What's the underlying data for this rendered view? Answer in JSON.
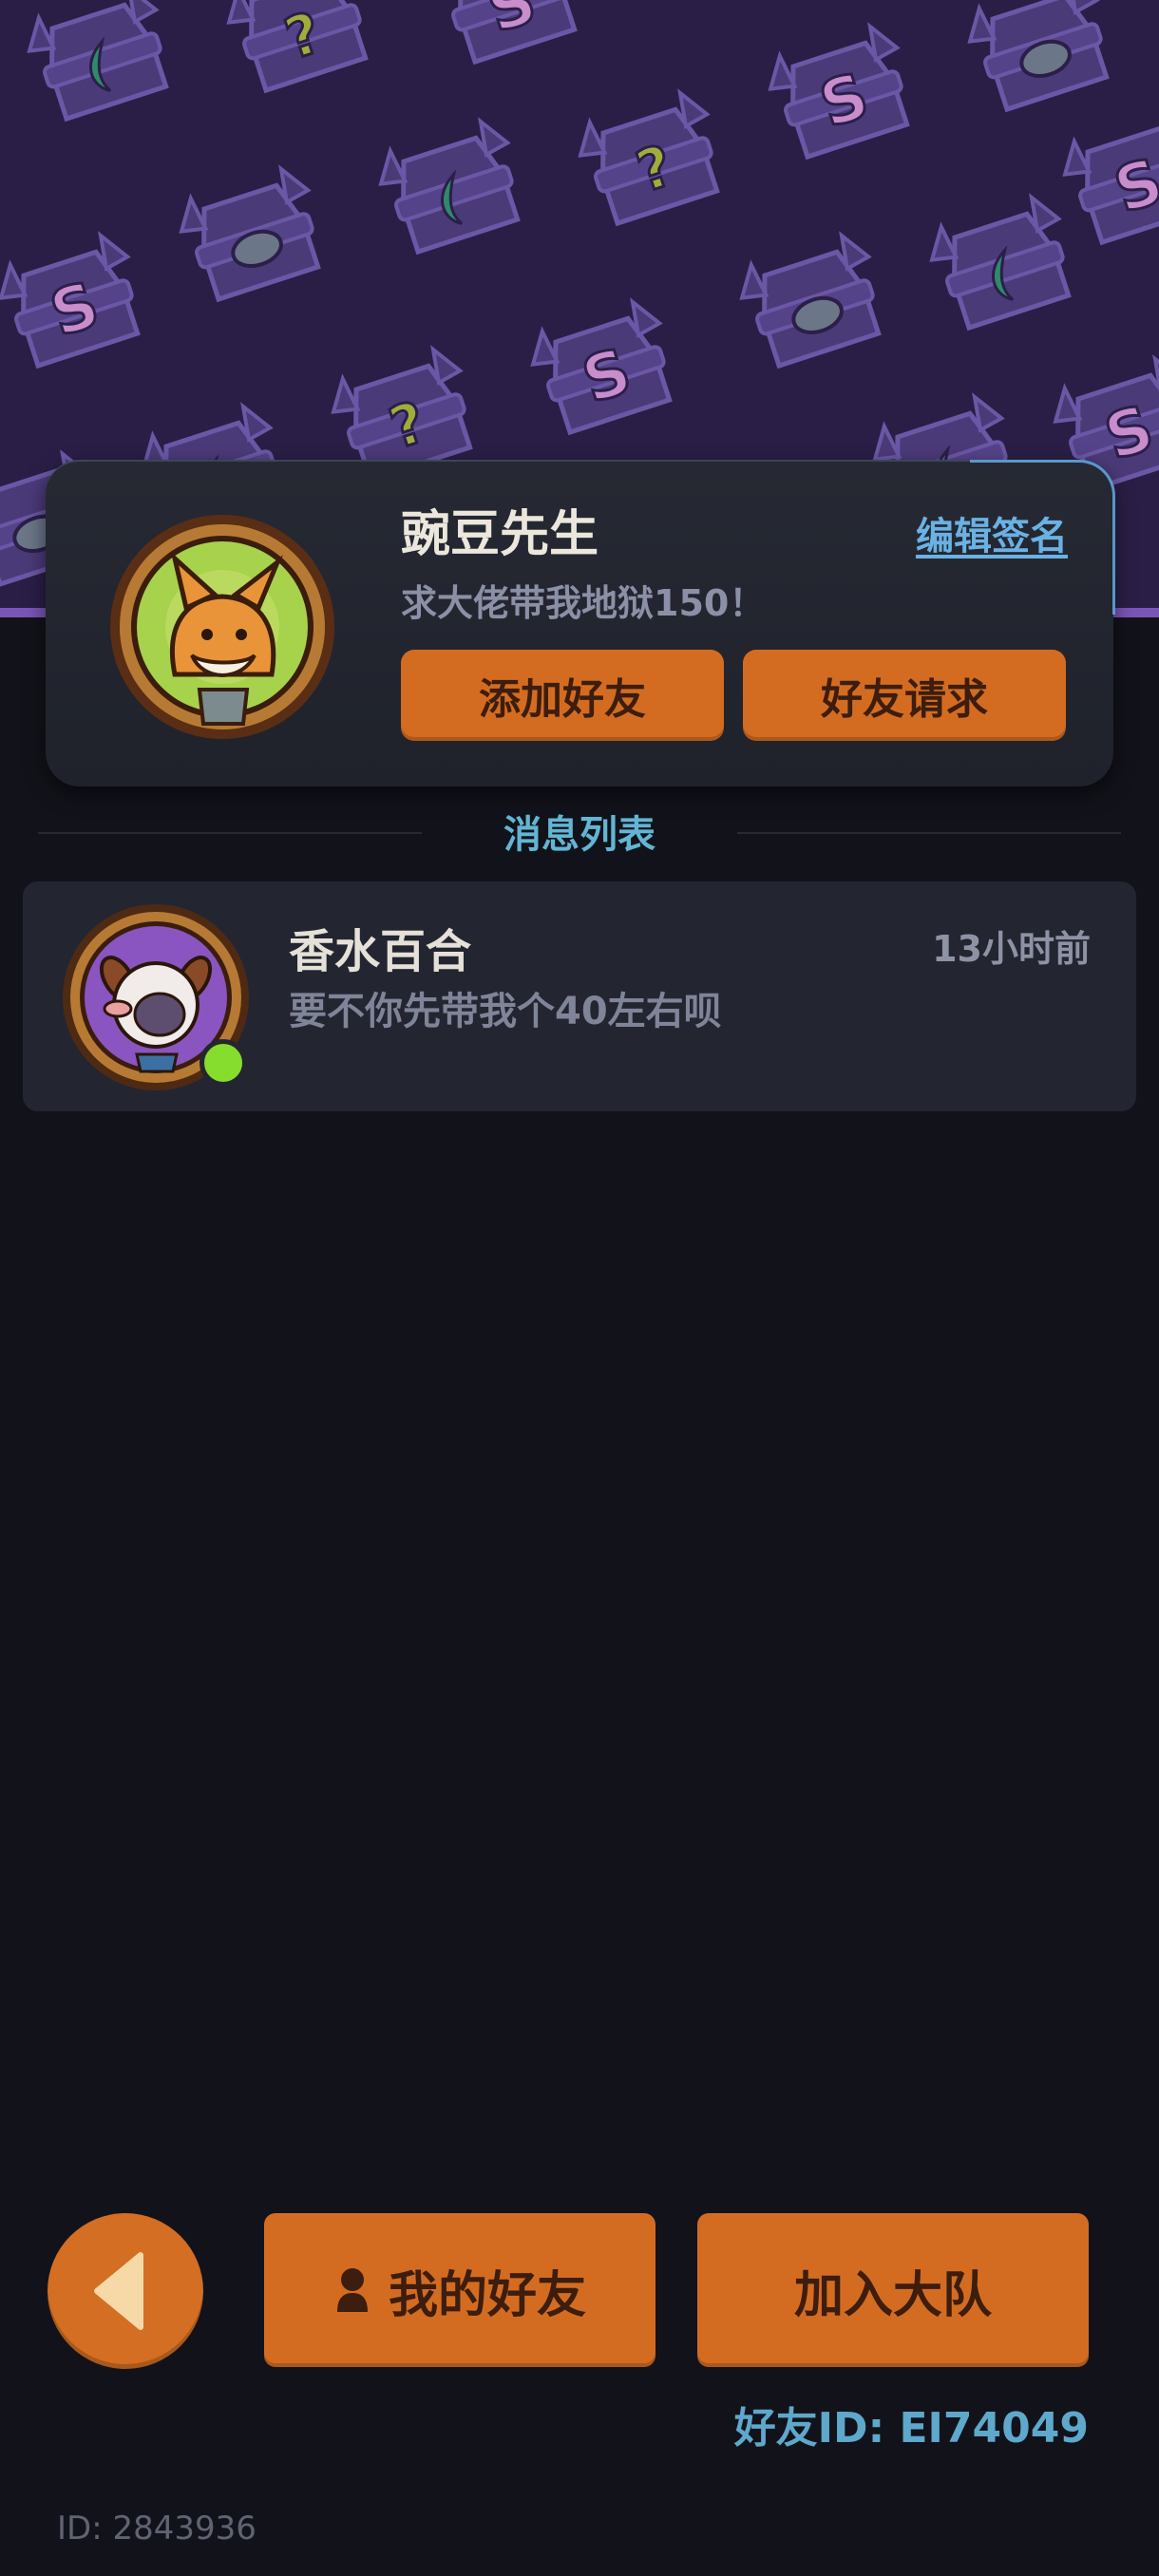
{
  "profile": {
    "name": "豌豆先生",
    "signature": "求大佬带我地狱150！",
    "edit_sign_label": "编辑签名",
    "add_friend_label": "添加好友",
    "friend_request_label": "好友请求"
  },
  "messages": {
    "section_title": "消息列表",
    "items": [
      {
        "name": "香水百合",
        "time": "13小时前",
        "preview": "要不你先带我个40左右呗",
        "online": true
      }
    ]
  },
  "bottom": {
    "my_friends_label": "我的好友",
    "join_team_label": "加入大队",
    "friend_id_text": "好友ID: EI74049",
    "self_id_text": "ID: 2843936"
  },
  "colors": {
    "accent_orange": "#d36c21",
    "link_blue": "#6ab1e4",
    "online_green": "#86dd2c",
    "background": "#12131a"
  },
  "icons": [
    "back-arrow-icon",
    "person-icon",
    "online-status-icon"
  ]
}
